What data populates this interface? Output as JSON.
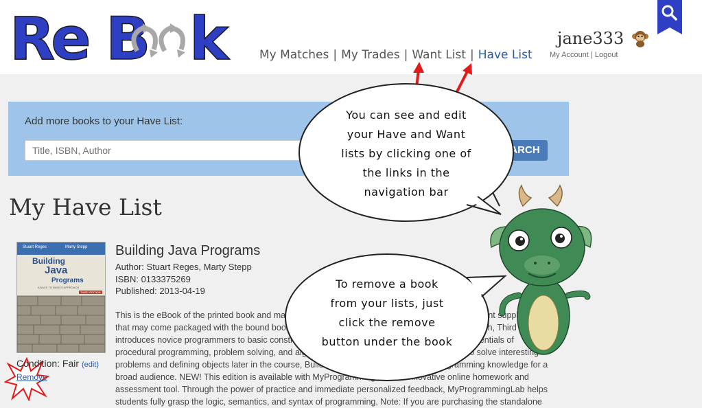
{
  "logo": {
    "text": "ReBook"
  },
  "nav": {
    "items": [
      {
        "label": "My Matches"
      },
      {
        "label": "My Trades"
      },
      {
        "label": "Want List"
      },
      {
        "label": "Have List"
      }
    ],
    "active": "Have List"
  },
  "user": {
    "name": "jane333",
    "account_label": "My Account",
    "logout_label": "Logout"
  },
  "add_books": {
    "label": "Add more books to your Have List:",
    "placeholder": "Title, ISBN, Author",
    "search_label": "SEARCH"
  },
  "page_title": "My Have List",
  "book": {
    "cover": {
      "authors": [
        "Stuart Reges",
        "Marty Stepp"
      ],
      "title_lines": [
        "Building",
        "Java",
        "Programs"
      ],
      "subtitle": "A BACK TO BASICS APPROACH",
      "edition": "THIRD EDITION"
    },
    "title": "Building Java Programs",
    "author": "Author: Stuart Reges, Marty Stepp",
    "isbn": "ISBN: 0133375269",
    "published": "Published: 2013-04-19",
    "description": "This is the eBook of the printed book and may not include any media, website access codes, or print supplements that may come packaged with the bound book. Building Java Programs: A Back to Basics Approach, Third Edition, introduces novice programmers to basic constructs and common pitfalls by emphasizing the essentials of procedural programming, problem solving, and algorithmic reasoning. By using objects early to solve interesting problems and defining objects later in the course, Building Java Programs develops programming knowledge for a broad audience. NEW! This edition is available with MyProgrammingLab, an innovative online homework and assessment tool. Through the power of practice and immediate personalized feedback, MyProgrammingLab helps students fully grasp the logic, semantics, and syntax of programming. Note: If you are purchasing the standalone",
    "condition_label": "Condition: Fair",
    "edit_label": "(edit)",
    "remove_label": "Remove"
  },
  "callouts": {
    "nav_tip": [
      "You can see and edit",
      "your Have and Want",
      "lists by clicking one of",
      "the links in the",
      "navigation bar"
    ],
    "remove_tip": [
      "To remove a book",
      "from your lists, just",
      "click the remove",
      "button under the book"
    ]
  },
  "colors": {
    "logo_blue": "#2f3fc4",
    "link_blue": "#2a5aa8",
    "search_box": "#9ec4ea",
    "search_button": "#4b7ab8",
    "arrow_red": "#e21a1a",
    "dragon_green": "#3f8a55"
  }
}
